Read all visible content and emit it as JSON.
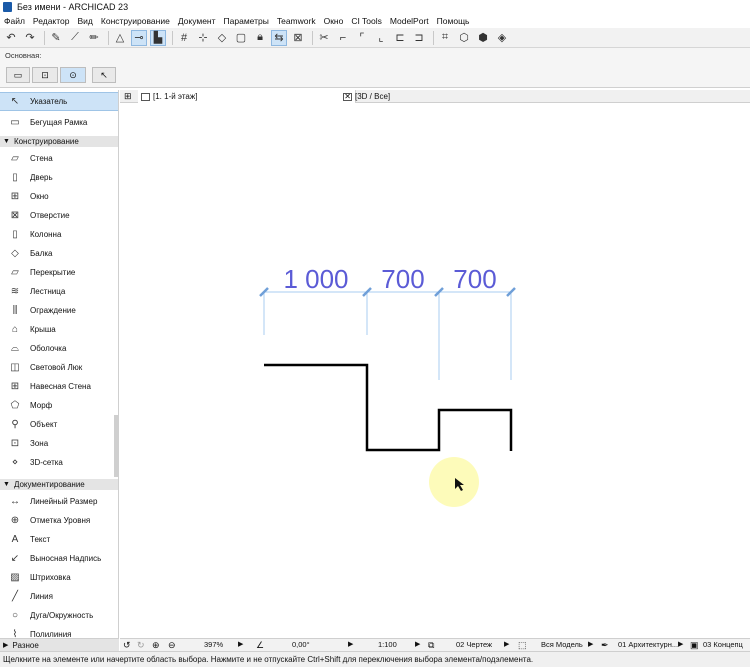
{
  "window": {
    "title": "Без имени - ARCHICAD 23"
  },
  "menu": [
    "Файл",
    "Редактор",
    "Вид",
    "Конструирование",
    "Документ",
    "Параметры",
    "Teamwork",
    "Окно",
    "CI Tools",
    "ModelPort",
    "Помощь"
  ],
  "infobox": {
    "label": "Основная:"
  },
  "toolbox": {
    "pointer": "Указатель",
    "marquee": "Бегущая Рамка",
    "sections": {
      "design": "Конструирование",
      "document": "Документирование",
      "more": "Разное"
    },
    "design_items": [
      "Стена",
      "Дверь",
      "Окно",
      "Отверстие",
      "Колонна",
      "Балка",
      "Перекрытие",
      "Лестница",
      "Ограждение",
      "Крыша",
      "Оболочка",
      "Световой Люк",
      "Навесная Стена",
      "Морф",
      "Объект",
      "Зона",
      "3D-сетка"
    ],
    "document_items": [
      "Линейный Размер",
      "Отметка Уровня",
      "Текст",
      "Выносная Надпись",
      "Штриховка",
      "Линия",
      "Дуга/Окружность",
      "Полилиния"
    ]
  },
  "tabs": [
    {
      "label": "[1. 1-й этаж]"
    },
    {
      "label": "[3D / Все]"
    }
  ],
  "drawing": {
    "dimensions": [
      "1 000",
      "700",
      "700"
    ],
    "dim_color": "#5b5bd6"
  },
  "statusbar": {
    "zoom": "397%",
    "angle": "0,00°",
    "scale": "1:100",
    "layer_combo": "02 Чертеж",
    "model_view": "Вся Модель",
    "pen_set": "01 Архитектурн...",
    "concept": "03 Концепц"
  },
  "hint": "Щелкните на элементе или начертите область выбора. Нажмите и не отпускайте Ctrl+Shift для переключения выбора элемента/подэлемента."
}
